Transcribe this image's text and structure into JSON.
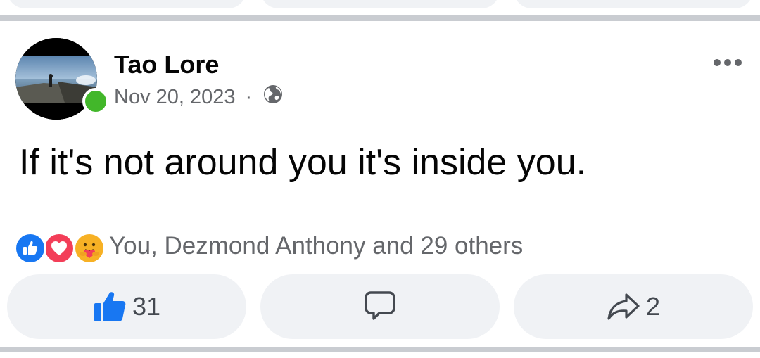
{
  "post": {
    "author": "Tao Lore",
    "date": "Nov 20, 2023",
    "separator": "·",
    "privacy_icon": "globe-icon",
    "text": "If it's not around you it's inside you.",
    "more_icon": "more-options-icon"
  },
  "reactions": {
    "icons": [
      "like-reaction-icon",
      "love-reaction-icon",
      "care-reaction-icon"
    ],
    "summary": "You, Dezmond Anthony and 29 others"
  },
  "actions": {
    "like": {
      "icon": "thumbs-up-icon",
      "count": "31"
    },
    "comment": {
      "icon": "comment-icon"
    },
    "share": {
      "icon": "share-icon",
      "count": "2"
    }
  },
  "colors": {
    "accent_blue": "#1877f2",
    "online_green": "#42b72a",
    "secondary_text": "#65676b",
    "button_bg": "#f0f2f5",
    "divider": "#c9ccd1"
  }
}
